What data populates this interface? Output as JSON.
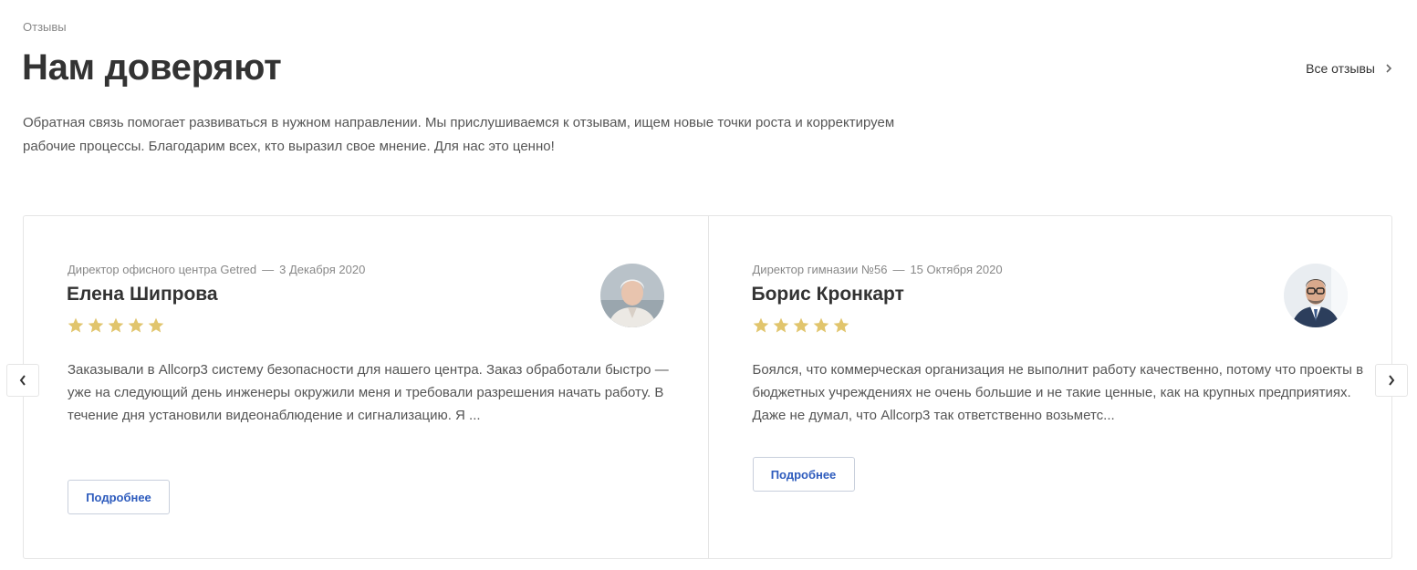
{
  "header": {
    "eyebrow": "Отзывы",
    "title": "Нам доверяют",
    "all_link": "Все отзывы",
    "lead": "Обратная связь помогает развиваться в нужном направлении. Мы прислушиваемся к отзывам, ищем новые точки роста и корректируем рабочие процессы. Благодарим всех, кто выразил свое мнение. Для нас это ценно!"
  },
  "reviews": [
    {
      "position": "Директор офисного центра Getred",
      "separator": "—",
      "date": "3 Декабря 2020",
      "name": "Елена Шипрова",
      "rating": 5,
      "text": "Заказывали в Allcorp3 систему безопасности для нашего центра. Заказ обработали быстро — уже на следующий день инженеры окружили меня и требовали разрешения начать работу. В течение дня установили видеонаблюдение и сигнализацию. Я ...",
      "button": "Подробнее"
    },
    {
      "position": "Директор гимназии №56",
      "separator": "—",
      "date": "15 Октября 2020",
      "name": "Борис Кронкарт",
      "rating": 5,
      "text": "Боялся, что коммерческая организация не выполнит работу качественно, потому что проекты в бюджетных учреждениях не очень большие и не такие ценные, как на крупных предприятиях. Даже не думал, что Allcorp3 так ответственно возьметс...",
      "button": "Подробнее"
    }
  ],
  "colors": {
    "star": "#e1c56d",
    "button_text": "#2d5bbd",
    "border": "#e5e5e5"
  },
  "icons": {
    "all_link": "chevron-right-icon",
    "prev": "chevron-left-icon",
    "next": "chevron-right-icon",
    "rating": "star-icon"
  }
}
